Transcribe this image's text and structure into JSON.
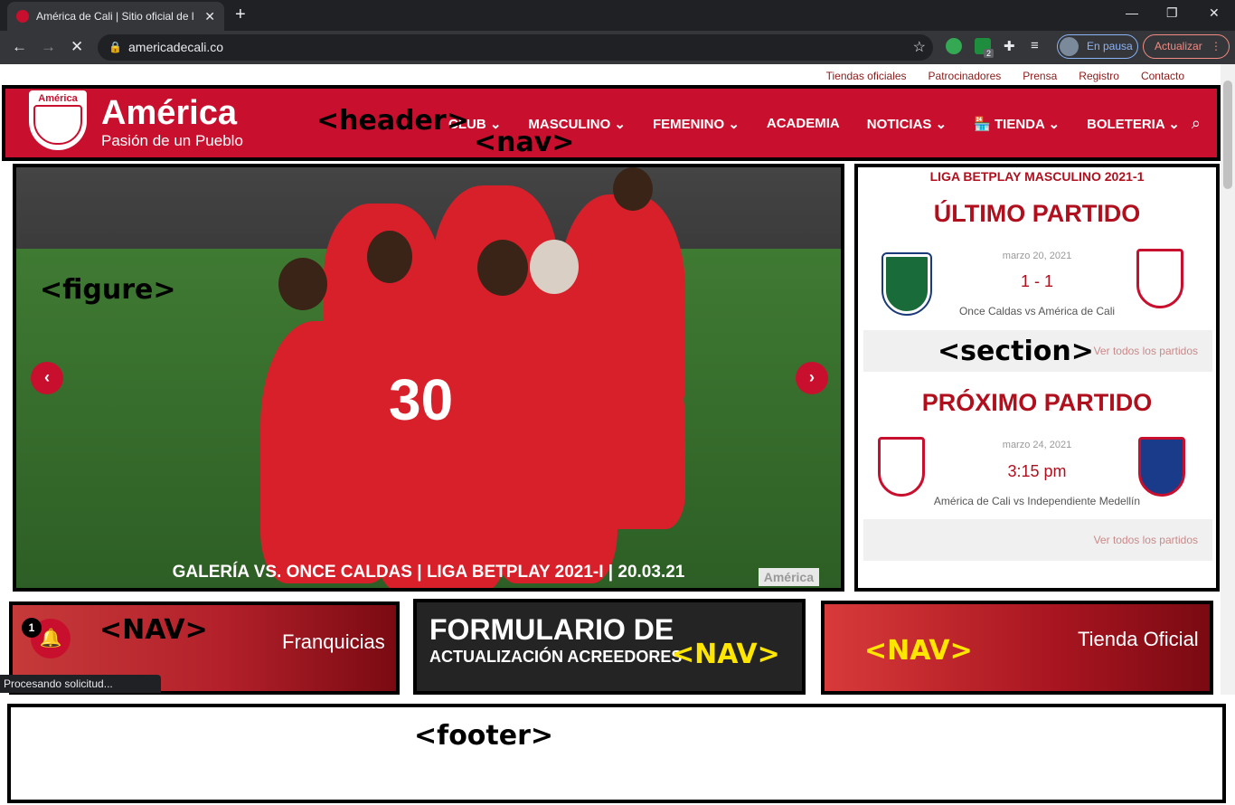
{
  "browser": {
    "tab_title": "América de Cali | Sitio oficial de l",
    "url": "americadecali.co",
    "profile_label": "En pausa",
    "update_label": "Actualizar",
    "ext_badge": "2",
    "status_text": "Procesando solicitud..."
  },
  "top_menu": [
    "Tiendas oficiales",
    "Patrocinadores",
    "Prensa",
    "Registro",
    "Contacto"
  ],
  "header": {
    "brand": "América",
    "tagline": "Pasión de un Pueblo",
    "shield_text": "América",
    "menu": [
      "CLUB ⌄",
      "MASCULINO ⌄",
      "FEMENINO ⌄",
      "ACADEMIA",
      "NOTICIAS ⌄",
      "TIENDA ⌄",
      "BOLETERIA ⌄"
    ]
  },
  "figure": {
    "caption": "GALERÍA VS. ONCE CALDAS | LIGA BETPLAY 2021-I | 20.03.21",
    "watermark": "América",
    "jersey": "30"
  },
  "matches": {
    "league": "LIGA BETPLAY MASCULINO 2021-1",
    "last": {
      "heading": "ÚLTIMO PARTIDO",
      "date": "marzo 20, 2021",
      "score": "1 - 1",
      "teams": "Once Caldas vs América de Cali",
      "see_all": "Ver todos los partidos"
    },
    "next": {
      "heading": "PRÓXIMO PARTIDO",
      "date": "marzo 24, 2021",
      "time": "3:15 pm",
      "teams": "América de Cali vs Independiente Medellín",
      "see_all": "Ver todos los partidos"
    }
  },
  "banners": {
    "franquicias": "Franquicias",
    "form_line1": "FORMULARIO DE",
    "form_line2": "ACTUALIZACIÓN ACREEDORES",
    "tienda": "Tienda Oficial"
  },
  "notification_count": "1",
  "annotations": {
    "header": "<header>",
    "nav": "<nav>",
    "figure": "<figure>",
    "section": "<section>",
    "nav_upper": "<NAV>",
    "footer": "<footer>"
  },
  "colors": {
    "brand_red": "#c8102e",
    "dark_red": "#b0101e",
    "annotation_yellow": "#ffe600"
  }
}
